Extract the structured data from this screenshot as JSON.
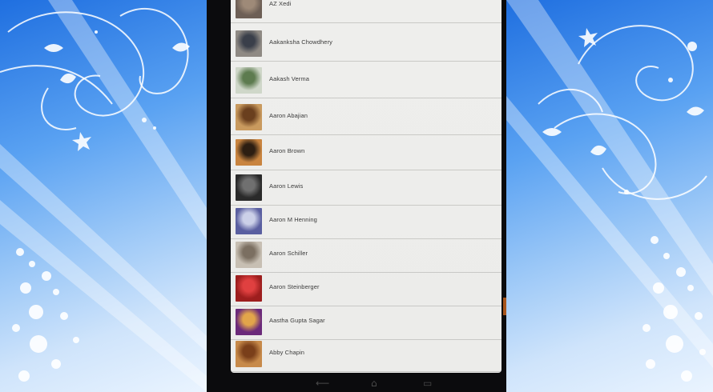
{
  "contacts": [
    {
      "name": "AZ Xedi",
      "avatar_color": "#6d5f56",
      "avatar_accent": "#9e8a78"
    },
    {
      "name": "Aakanksha Chowdhery",
      "avatar_color": "#8f8a84",
      "avatar_accent": "#3a3f4a"
    },
    {
      "name": "Aakash Verma",
      "avatar_color": "#cfd7c9",
      "avatar_accent": "#5d7b4f"
    },
    {
      "name": "Aaron Abajian",
      "avatar_color": "#c99a5e",
      "avatar_accent": "#6a3f1e"
    },
    {
      "name": "Aaron Brown",
      "avatar_color": "#c9843f",
      "avatar_accent": "#2d1e12"
    },
    {
      "name": "Aaron Lewis",
      "avatar_color": "#2a2a2a",
      "avatar_accent": "#707070"
    },
    {
      "name": "Aaron M Henning",
      "avatar_color": "#5a5fa0",
      "avatar_accent": "#cbd0e8"
    },
    {
      "name": "Aaron Schiller",
      "avatar_color": "#c7bfb3",
      "avatar_accent": "#7b6f61"
    },
    {
      "name": "Aaron Steinberger",
      "avatar_color": "#9d1e1e",
      "avatar_accent": "#e04040"
    },
    {
      "name": "Aastha Gupta Sagar",
      "avatar_color": "#6b2a7a",
      "avatar_accent": "#e2a54a"
    },
    {
      "name": "Abby Chapin",
      "avatar_color": "#c78a4a",
      "avatar_accent": "#7a3f1a"
    }
  ],
  "nav": {
    "back_glyph": "⟵",
    "home_glyph": "⌂",
    "recent_glyph": "▭"
  }
}
